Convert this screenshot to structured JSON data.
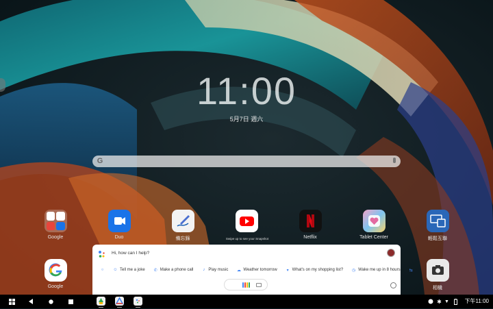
{
  "lockscreen": {
    "time": "11:00",
    "date": "5月7日 週六"
  },
  "search": {
    "logo": "G"
  },
  "apps": [
    {
      "name": "Google",
      "icon": "google-folder-icon"
    },
    {
      "name": "Duo",
      "icon": "duo-icon"
    },
    {
      "name": "備忘錄",
      "icon": "notes-icon"
    },
    {
      "name": "",
      "icon": "youtube-icon"
    },
    {
      "name": "Netflix",
      "icon": "netflix-icon"
    },
    {
      "name": "Tablet Center",
      "icon": "tablet-center-icon"
    },
    {
      "name": "輕鬆互聯",
      "icon": "connect-icon"
    },
    {
      "name": "Google",
      "icon": "google-icon"
    },
    {
      "name": "相機",
      "icon": "camera-icon"
    }
  ],
  "snapshot_hint": "Swipe up to see your Snapshot",
  "assistant": {
    "greeting": "Hi, how can I help?",
    "chips": [
      {
        "icon": "smile-icon",
        "label": "Tell me a joke"
      },
      {
        "icon": "phone-icon",
        "label": "Make a phone call"
      },
      {
        "icon": "music-icon",
        "label": "Play music"
      },
      {
        "icon": "cloud-icon",
        "label": "Weather tomorrow"
      },
      {
        "icon": "cart-icon",
        "label": "What's on my shopping list?"
      },
      {
        "icon": "alarm-icon",
        "label": "Wake me up in 8 hours"
      }
    ],
    "colors": {
      "blue": "#4285f4",
      "red": "#ea4335",
      "yellow": "#fbbc05",
      "green": "#34a853"
    }
  },
  "taskbar": {
    "nav": [
      "apps-grid-icon",
      "back-icon",
      "home-icon",
      "recents-icon"
    ],
    "time": "下午11:00"
  }
}
